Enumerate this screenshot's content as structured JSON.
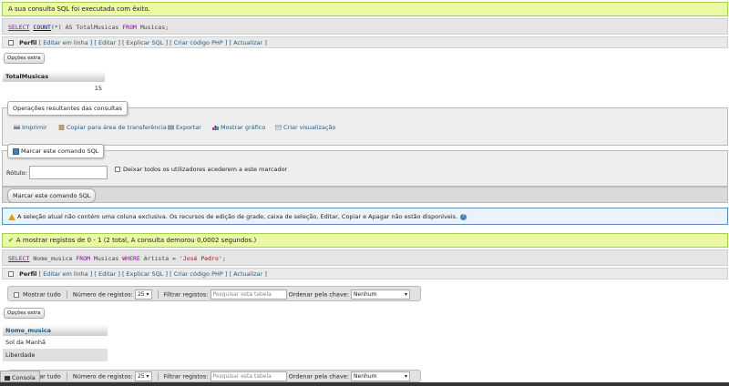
{
  "query1": {
    "success_msg": "A sua consulta SQL foi executada com êxito.",
    "sql_kw1": "SELECT",
    "sql_fn": "COUNT",
    "sql_rest1": "(*) AS TotalMusicas ",
    "sql_kw2": "FROM",
    "sql_rest2": " Musicas;",
    "links": {
      "profile": "Perfil",
      "edit_inline": "[ Editar em linha ]",
      "edit": "[ Editar ]",
      "explain": "[ Explicar SQL ]",
      "php": "[ Criar código PHP ]",
      "refresh": "[ Actualizar ]"
    },
    "extra_btn": "Opções extra",
    "table": {
      "header": "TotalMusicas",
      "value": "15"
    }
  },
  "ops": {
    "legend": "Operações resultantes das consultas",
    "print": "Imprimir",
    "copy": "Copiar para área de transferência",
    "export": "Exportar",
    "chart": "Mostrar gráfico",
    "view": "Criar visualização"
  },
  "bookmark": {
    "legend": "Marcar este comando SQL",
    "label": "Rótulo:",
    "share": "Deixar todos os utilizadores acederem a este marcador",
    "button": "Marcar este comando SQL"
  },
  "notice": "A seleção atual não contém uma coluna exclusiva. Os recursos de edição de grade, caixa de seleção, Editar, Copiar e Apagar não estão disponíveis.",
  "query2": {
    "success_msg": "A mostrar registos de 0 - 1 (2 total, A consulta demorou 0,0002 segundos.)",
    "sql_kw1": "SELECT",
    "sql_rest1": " Nome_musica ",
    "sql_kw2": "FROM",
    "sql_rest2": " Musicas ",
    "sql_kw3": "WHERE",
    "sql_rest3": " Artista = ",
    "sql_str": "'José Pedro'",
    "sql_end": ";",
    "links": {
      "profile": "Perfil",
      "edit_inline": "[ Editar em linha ]",
      "edit": "[ Editar ]",
      "explain": "[ Explicar SQL ]",
      "php": "[ Criar código PHP ]",
      "refresh": "[ Actualizar ]"
    },
    "nav": {
      "show_all": "Mostrar tudo",
      "rows_label": "Número de registos:",
      "rows_value": "25",
      "filter_label": "Filtrar registos:",
      "filter_placeholder": "Pesquisar esta tabela",
      "sort_label": "Ordenar pela chave:",
      "sort_value": "Nenhum"
    },
    "extra_btn": "Opções extra",
    "table": {
      "header": "Nome_musica",
      "rows": [
        "Sol da Manhã",
        "Liberdade"
      ]
    },
    "nav_bottom": {
      "show_all": "Mostrar tudo",
      "rows_label": "Número de registos:",
      "rows_value": "25",
      "filter_label": "Filtrar registos:",
      "filter_placeholder": "Pesquisar esta tabela",
      "sort_label": "Ordenar pela chave:",
      "sort_value": "Nenhum"
    }
  },
  "console": "Consola"
}
